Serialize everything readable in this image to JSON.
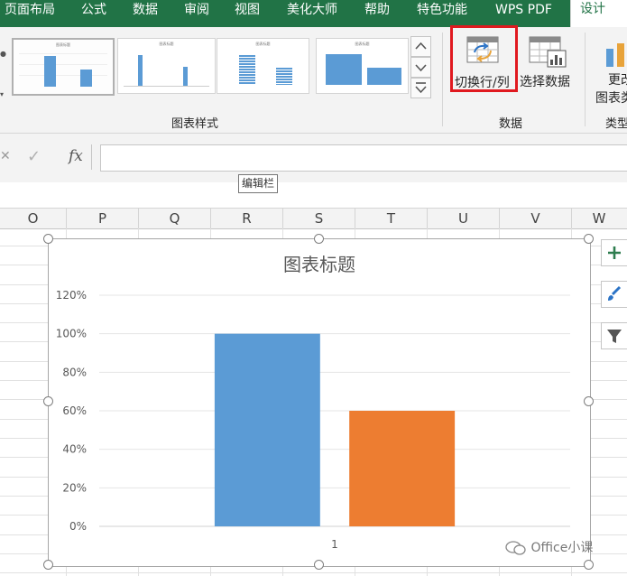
{
  "ribbon_tabs": [
    {
      "label": "页面布局",
      "active": false
    },
    {
      "label": "公式",
      "active": false
    },
    {
      "label": "数据",
      "active": false
    },
    {
      "label": "审阅",
      "active": false
    },
    {
      "label": "视图",
      "active": false
    },
    {
      "label": "美化大师",
      "active": false
    },
    {
      "label": "帮助",
      "active": false
    },
    {
      "label": "特色功能",
      "active": false
    },
    {
      "label": "WPS PDF",
      "active": false
    },
    {
      "label": "设计",
      "active": true
    }
  ],
  "ribbon": {
    "chart_styles_label": "图表样式",
    "style_thumbnails": [
      "图表标题",
      "图表标题",
      "图表标题",
      "图表标题"
    ],
    "switch_row_col_label": "切换行/列",
    "select_data_label": "选择数据",
    "data_group_label": "数据",
    "change_type_label_1": "更改",
    "change_type_label_2": "图表类",
    "type_group_label": "类型",
    "highlight_color": "#e0191f"
  },
  "formula_bar": {
    "cancel_glyph": "✕",
    "enter_glyph": "✓",
    "fx_label": "fx",
    "value": "",
    "tooltip": "编辑栏"
  },
  "columns": [
    "O",
    "P",
    "Q",
    "R",
    "S",
    "T",
    "U",
    "V",
    "W"
  ],
  "chart_data": {
    "type": "bar",
    "title": "图表标题",
    "categories": [
      "1"
    ],
    "series": [
      {
        "values": [
          1.0
        ],
        "color": "#5b9bd5"
      },
      {
        "values": [
          0.6
        ],
        "color": "#ed7d31"
      }
    ],
    "ylim": [
      0,
      1.2
    ],
    "yticks": [
      "0%",
      "20%",
      "40%",
      "60%",
      "80%",
      "100%",
      "120%"
    ],
    "grid": true,
    "legend": "none"
  },
  "chart_buttons": [
    "plus-icon",
    "brush-icon",
    "filter-icon"
  ],
  "watermark": "Office小课"
}
